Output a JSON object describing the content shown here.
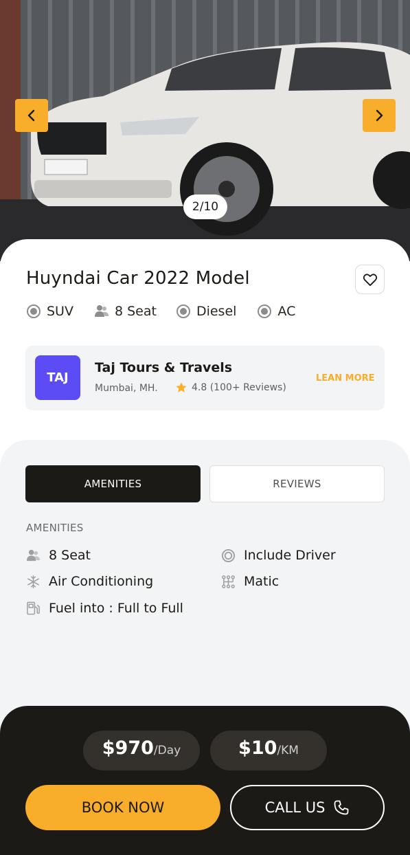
{
  "gallery": {
    "counter": "2/10",
    "prev_icon": "chevron-left-icon",
    "next_icon": "chevron-right-icon"
  },
  "car": {
    "title": "Huyndai Car 2022 Model",
    "favorite_icon": "heart-icon",
    "features": [
      {
        "icon": "target-icon",
        "label": "SUV"
      },
      {
        "icon": "users-icon",
        "label": "8 Seat"
      },
      {
        "icon": "target-icon",
        "label": "Diesel"
      },
      {
        "icon": "target-icon",
        "label": "AC"
      }
    ]
  },
  "vendor": {
    "logo_text": "TAJ",
    "name": "Taj Tours & Travels",
    "location": "Mumbai, MH.",
    "rating": "4.8 (100+ Reviews)",
    "learn_more": "LEAN MORE"
  },
  "tabs": {
    "amenities": "AMENITIES",
    "reviews": "REVIEWS"
  },
  "amenities": {
    "heading": "AMENITIES",
    "items": [
      {
        "icon": "users-icon",
        "label": "8 Seat"
      },
      {
        "icon": "steering-wheel-icon",
        "label": "Include Driver"
      },
      {
        "icon": "snowflake-icon",
        "label": "Air Conditioning"
      },
      {
        "icon": "gearbox-icon",
        "label": "Matic"
      },
      {
        "icon": "fuel-pump-icon",
        "label": "Fuel into : Full to Full"
      }
    ]
  },
  "pricing": {
    "day_value": "$970",
    "day_unit": "/Day",
    "km_value": "$10",
    "km_unit": "/KM"
  },
  "actions": {
    "book": "BOOK NOW",
    "call": "CALL US",
    "call_icon": "phone-icon"
  },
  "colors": {
    "accent": "#f8ae2b",
    "dark": "#1c1a16",
    "vendor_logo": "#5b4cf5"
  }
}
